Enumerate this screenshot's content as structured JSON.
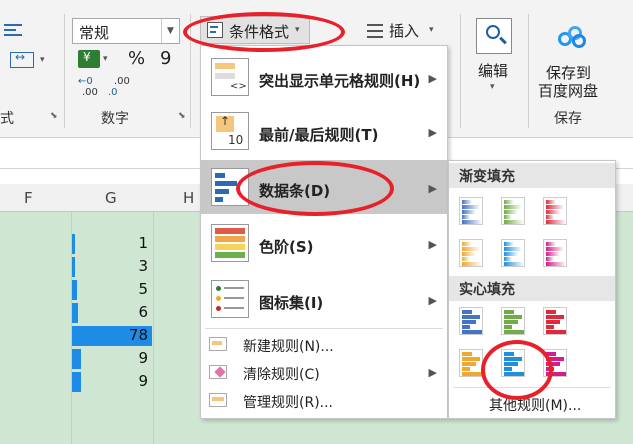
{
  "ribbon": {
    "number_format": "常规",
    "percent": "%",
    "comma": "9",
    "inc_decimal": ".00",
    "dec_decimal": ".0",
    "group_left_fragment": "式",
    "group_number": "数字",
    "conditional_format": "条件格式",
    "insert": "插入",
    "edit": "编辑",
    "save_line1": "保存到",
    "save_line2": "百度网盘",
    "save_group": "保存"
  },
  "columns": [
    "F",
    "G",
    "H"
  ],
  "cells": [
    {
      "value": "1",
      "fill": 0.013
    },
    {
      "value": "3",
      "fill": 0.038
    },
    {
      "value": "5",
      "fill": 0.064
    },
    {
      "value": "6",
      "fill": 0.077
    },
    {
      "value": "78",
      "fill": 1.0
    },
    {
      "value": "9",
      "fill": 0.115
    },
    {
      "value": "9",
      "fill": 0.115
    }
  ],
  "menu": {
    "highlight": "突出显示单元格规则(H)",
    "topbottom": "最前/最后规则(T)",
    "topbottom_icon_text": "10",
    "databar": "数据条(D)",
    "colorscale": "色阶(S)",
    "iconset": "图标集(I)",
    "new_rule": "新建规则(N)...",
    "clear_rule": "清除规则(C)",
    "manage_rule": "管理规则(R)..."
  },
  "submenu": {
    "gradient": "渐变填充",
    "solid": "实心填充",
    "more_rules": "其他规则(M)...",
    "colors": [
      "#4472c4",
      "#70ad47",
      "#e02a3c",
      "#f0a830",
      "#1f8fe0",
      "#d81b8a"
    ]
  }
}
